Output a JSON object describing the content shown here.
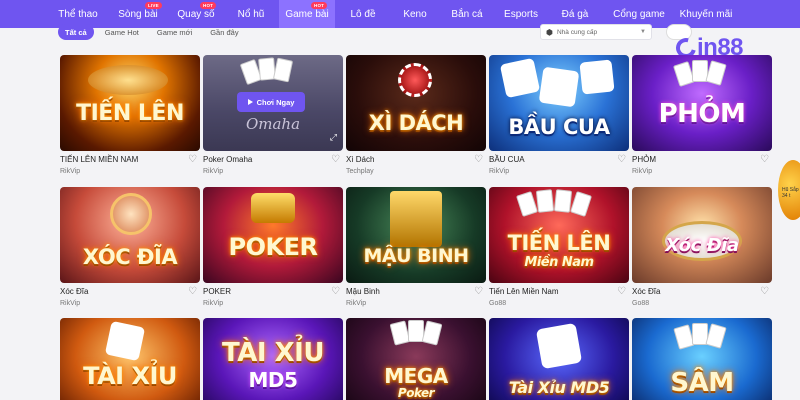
{
  "nav": {
    "items": [
      {
        "label": "Thể thao",
        "badge": ""
      },
      {
        "label": "Sòng bài",
        "badge": "LIVE"
      },
      {
        "label": "Quay số",
        "badge": "HOT"
      },
      {
        "label": "Nổ hũ",
        "badge": ""
      },
      {
        "label": "Game bài",
        "badge": "HOT"
      },
      {
        "label": "Lô đề",
        "badge": ""
      },
      {
        "label": "Keno",
        "badge": ""
      },
      {
        "label": "Bắn cá",
        "badge": ""
      },
      {
        "label": "Esports",
        "badge": ""
      },
      {
        "label": "Đá gà",
        "badge": ""
      },
      {
        "label": "Cổng game",
        "badge": ""
      },
      {
        "label": "Khuyến mãi",
        "badge": ""
      }
    ]
  },
  "filters": {
    "tabs": [
      "Tất cả",
      "Game Hot",
      "Game mới",
      "Gần đây"
    ],
    "provider_placeholder": "Nhà cung cấp"
  },
  "logo": {
    "text": "in88"
  },
  "cards": [
    {
      "name": "TIẾN LÊN MIỀN NAM",
      "provider": "RikVip",
      "art": "TIẾN LÊN"
    },
    {
      "name": "Poker Omaha",
      "provider": "RikVip",
      "art": "Omaha",
      "play_label": "Chơi Ngay"
    },
    {
      "name": "Xì Dách",
      "provider": "Techplay",
      "art": "XÌ DÁCH"
    },
    {
      "name": "BẦU CUA",
      "provider": "RikVip",
      "art": "BẦU CUA"
    },
    {
      "name": "PHỎM",
      "provider": "RikVip",
      "art": "PHỎM"
    },
    {
      "name": "Xóc Đĩa",
      "provider": "RikVip",
      "art": "XÓC ĐĨA"
    },
    {
      "name": "POKER",
      "provider": "RikVip",
      "art": "POKER"
    },
    {
      "name": "Mậu Binh",
      "provider": "RikVip",
      "art": "MẬU BINH"
    },
    {
      "name": "Tiến Lên Miền Nam",
      "provider": "Go88",
      "art": "TIẾN LÊN",
      "art2": "Miền Nam"
    },
    {
      "name": "Xóc Đĩa",
      "provider": "Go88",
      "art": "Xóc Đĩa"
    },
    {
      "name": "",
      "provider": "",
      "art": "TÀI XỈU"
    },
    {
      "name": "",
      "provider": "",
      "art": "TÀI XỈU",
      "art2": "MD5"
    },
    {
      "name": "",
      "provider": "",
      "art": "MEGA",
      "art2": "Poker"
    },
    {
      "name": "",
      "provider": "",
      "art": "Tài Xỉu MD5"
    },
    {
      "name": "",
      "provider": "",
      "art": "SÂM"
    }
  ],
  "promo": {
    "line1": "Hũ Sắp",
    "line2": "34 t"
  },
  "colors": {
    "primary": "#6f55f0",
    "badge": "#ff3b5c"
  }
}
